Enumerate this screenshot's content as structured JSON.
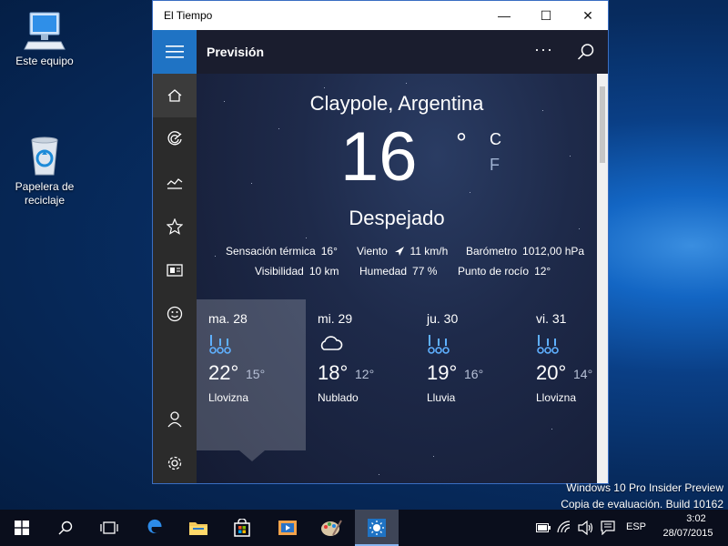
{
  "desktop": {
    "icons": [
      {
        "label": "Este equipo"
      },
      {
        "label": "Papelera de reciclaje"
      }
    ],
    "watermark": {
      "line1": "Windows 10 Pro Insider Preview",
      "line2": "Copia de evaluación. Build 10162"
    }
  },
  "window": {
    "title": "El Tiempo",
    "controls": {
      "minimize": "—",
      "maximize": "☐",
      "close": "✕"
    }
  },
  "header": {
    "title": "Previsión",
    "more": "···"
  },
  "current": {
    "city": "Claypole, Argentina",
    "temp": "16",
    "degree": "°",
    "unit_c": "C",
    "unit_f": "F",
    "condition": "Despejado",
    "details": {
      "feels_label": "Sensación térmica",
      "feels_value": "16°",
      "wind_label": "Viento",
      "wind_value": "11 km/h",
      "pressure_label": "Barómetro",
      "pressure_value": "1012,00 hPa",
      "visibility_label": "Visibilidad",
      "visibility_value": "10 km",
      "humidity_label": "Humedad",
      "humidity_value": "77 %",
      "dew_label": "Punto de rocío",
      "dew_value": "12°"
    }
  },
  "forecast": [
    {
      "day": "ma. 28",
      "icon": "drizzle-icon",
      "high": "22°",
      "low": "15°",
      "desc": "Llovizna"
    },
    {
      "day": "mi. 29",
      "icon": "cloud-icon",
      "high": "18°",
      "low": "12°",
      "desc": "Nublado"
    },
    {
      "day": "ju. 30",
      "icon": "rain-icon",
      "high": "19°",
      "low": "16°",
      "desc": "Lluvia"
    },
    {
      "day": "vi. 31",
      "icon": "drizzle-icon",
      "high": "20°",
      "low": "14°",
      "desc": "Llovizna"
    }
  ],
  "taskbar": {
    "language": "ESP",
    "time": "3:02",
    "date": "28/07/2015"
  },
  "colors": {
    "accent": "#1f73c4",
    "nav_bg": "#2b2b2b",
    "content_bg": "#1e2a4a"
  }
}
